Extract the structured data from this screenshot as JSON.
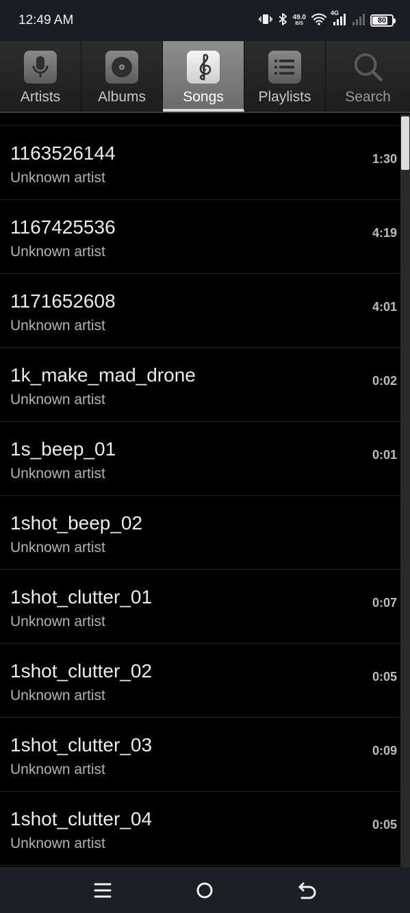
{
  "status_bar": {
    "time": "12:49 AM",
    "net_speed_value": "49.0",
    "net_speed_unit": "B/S",
    "network_type": "4G",
    "battery_text": "80",
    "battery_level_percent": 80,
    "icons": [
      "vibrate-icon",
      "bluetooth-icon",
      "wifi-icon",
      "signal-icon",
      "signal-icon-2",
      "battery-icon"
    ]
  },
  "tabs": [
    {
      "label": "Artists",
      "icon": "microphone-icon",
      "active": false
    },
    {
      "label": "Albums",
      "icon": "disc-icon",
      "active": false
    },
    {
      "label": "Songs",
      "icon": "treble-clef-icon",
      "active": true
    },
    {
      "label": "Playlists",
      "icon": "list-icon",
      "active": false
    },
    {
      "label": "Search",
      "icon": "search-icon",
      "active": false
    }
  ],
  "songs": [
    {
      "title": "1163526144",
      "artist": "Unknown artist",
      "duration": "1:30"
    },
    {
      "title": "1167425536",
      "artist": "Unknown artist",
      "duration": "4:19"
    },
    {
      "title": "1171652608",
      "artist": "Unknown artist",
      "duration": "4:01"
    },
    {
      "title": "1k_make_mad_drone",
      "artist": "Unknown artist",
      "duration": "0:02"
    },
    {
      "title": "1s_beep_01",
      "artist": "Unknown artist",
      "duration": "0:01"
    },
    {
      "title": "1shot_beep_02",
      "artist": "Unknown artist",
      "duration": ""
    },
    {
      "title": "1shot_clutter_01",
      "artist": "Unknown artist",
      "duration": "0:07"
    },
    {
      "title": "1shot_clutter_02",
      "artist": "Unknown artist",
      "duration": "0:05"
    },
    {
      "title": "1shot_clutter_03",
      "artist": "Unknown artist",
      "duration": "0:09"
    },
    {
      "title": "1shot_clutter_04",
      "artist": "Unknown artist",
      "duration": "0:05"
    }
  ],
  "nav_bar": {
    "buttons": [
      "menu-icon",
      "home-icon",
      "back-icon"
    ]
  },
  "colors": {
    "background": "#000000",
    "status_bar": "#1a1d21",
    "active_tab": "#8e8e8e",
    "text_primary": "#ececec",
    "text_secondary": "#b4b4b4"
  }
}
